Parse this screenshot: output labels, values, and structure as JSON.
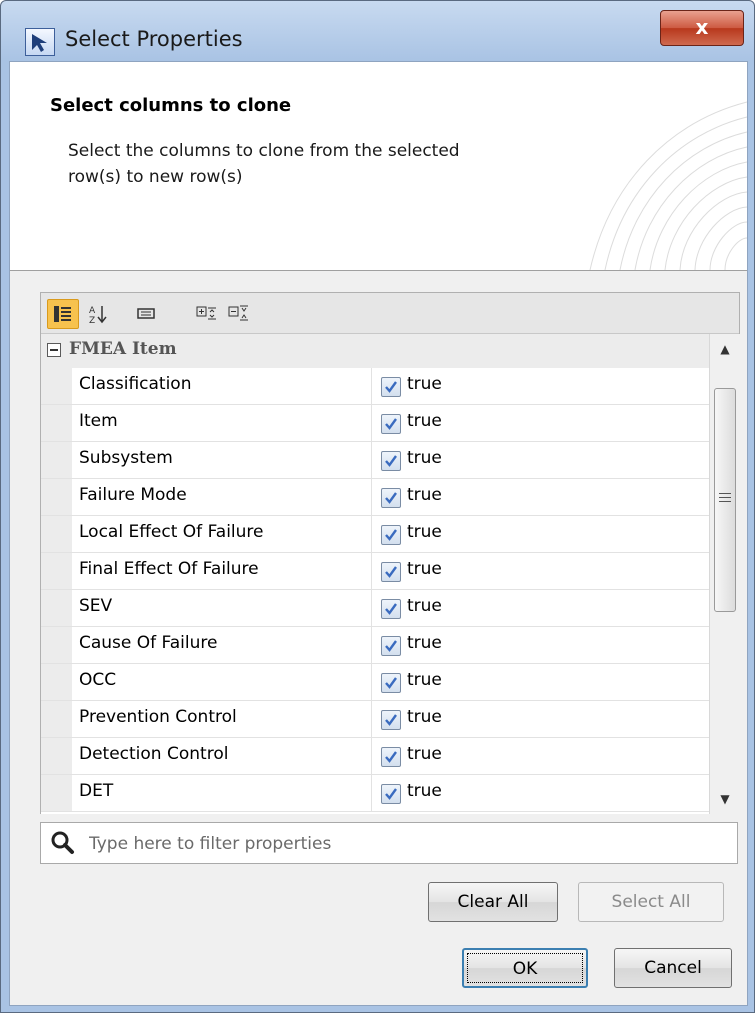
{
  "window": {
    "title": "Select Properties",
    "close_glyph": "x"
  },
  "header": {
    "title": "Select columns to clone",
    "description": "Select the columns to clone from the selected row(s) to new row(s)"
  },
  "toolbar": {
    "buttons": [
      {
        "name": "categorized-view-icon",
        "active": true
      },
      {
        "name": "sort-alphabetically-icon",
        "active": false
      },
      {
        "name": "description-area-icon",
        "active": false
      },
      {
        "name": "expand-all-icon",
        "active": false
      },
      {
        "name": "collapse-all-icon",
        "active": false
      }
    ]
  },
  "properties": {
    "group": "FMEA Item",
    "rows": [
      {
        "name": "Classification",
        "value": "true",
        "checked": true
      },
      {
        "name": "Item",
        "value": "true",
        "checked": true
      },
      {
        "name": "Subsystem",
        "value": "true",
        "checked": true
      },
      {
        "name": "Failure Mode",
        "value": "true",
        "checked": true
      },
      {
        "name": "Local Effect Of Failure",
        "value": "true",
        "checked": true
      },
      {
        "name": "Final Effect Of Failure",
        "value": "true",
        "checked": true
      },
      {
        "name": "SEV",
        "value": "true",
        "checked": true
      },
      {
        "name": "Cause Of Failure",
        "value": "true",
        "checked": true
      },
      {
        "name": "OCC",
        "value": "true",
        "checked": true
      },
      {
        "name": "Prevention Control",
        "value": "true",
        "checked": true
      },
      {
        "name": "Detection Control",
        "value": "true",
        "checked": true
      },
      {
        "name": "DET",
        "value": "true",
        "checked": true
      }
    ]
  },
  "filter": {
    "placeholder": "Type here to filter properties",
    "value": ""
  },
  "buttons": {
    "clear_all": "Clear All",
    "select_all": "Select All",
    "ok": "OK",
    "cancel": "Cancel"
  },
  "colors": {
    "accent": "#f7c24e",
    "close": "#cd5a42",
    "check": "#3a6bbf"
  }
}
